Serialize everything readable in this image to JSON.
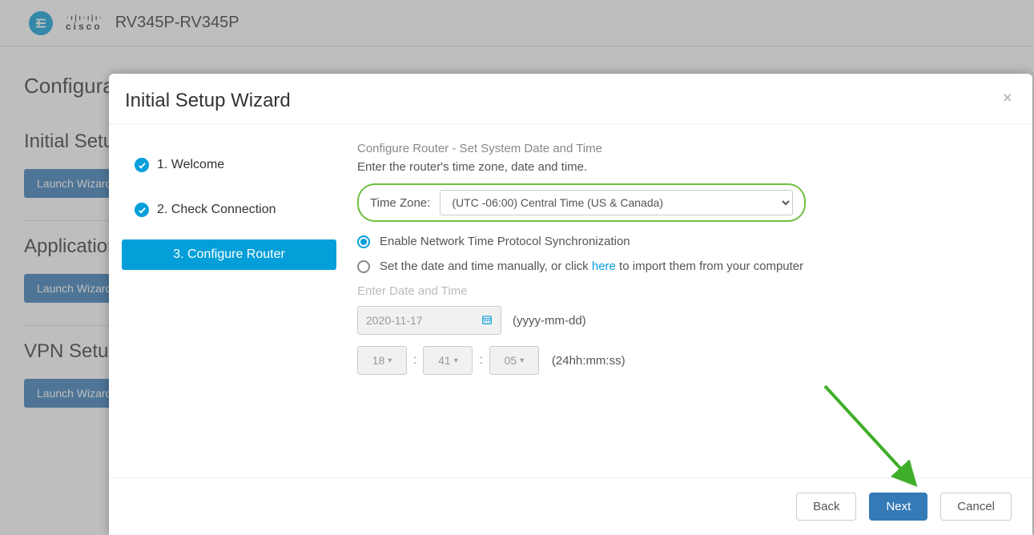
{
  "header": {
    "device_name": "RV345P-RV345P",
    "cisco_text": "cisco"
  },
  "page": {
    "title": "Configuration Wizards",
    "sections": {
      "initial": {
        "title": "Initial Setup Wizard",
        "button": "Launch Wizard"
      },
      "application": {
        "title": "Application Control Wizard",
        "button": "Launch Wizard"
      },
      "vpn": {
        "title": "VPN Setup Wizard",
        "button": "Launch Wizard"
      }
    }
  },
  "modal": {
    "title": "Initial Setup Wizard",
    "close_symbol": "×",
    "steps": {
      "s1": "1. Welcome",
      "s2": "2. Check Connection",
      "s3": "3. Configure Router"
    },
    "content": {
      "subtitle": "Configure Router - Set System Date and Time",
      "instruction": "Enter the router's time zone, date and time.",
      "tz_label": "Time Zone:",
      "tz_value": "(UTC -06:00) Central Time (US & Canada)",
      "radio1": "Enable Network Time Protocol Synchronization",
      "radio2_pre": "Set the date and time manually, or click ",
      "radio2_link": "here",
      "radio2_post": " to import them from your computer",
      "enter_dt": "Enter Date and Time",
      "date_value": "2020-11-17",
      "date_hint": "(yyyy-mm-dd)",
      "hh": "18",
      "mm": "41",
      "ss": "05",
      "time_hint": "(24hh:mm:ss)"
    },
    "footer": {
      "back": "Back",
      "next": "Next",
      "cancel": "Cancel"
    }
  }
}
